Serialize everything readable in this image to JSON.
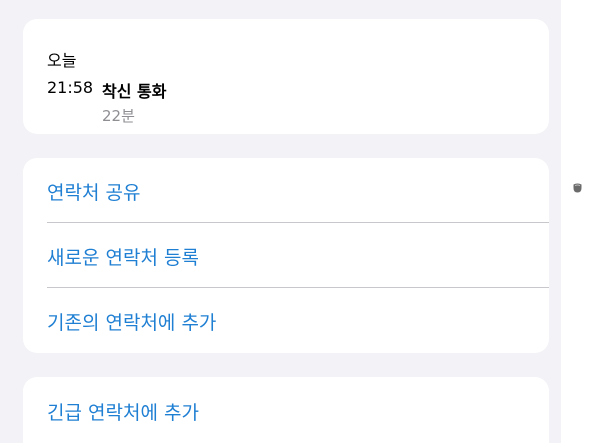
{
  "recents": {
    "day": "오늘",
    "time": "21:58",
    "type": "착신 통화",
    "duration": "22분"
  },
  "actions": [
    {
      "label": "연락처 공유"
    },
    {
      "label": "새로운 연락처 등록"
    },
    {
      "label": "기존의 연락처에 추가"
    }
  ],
  "emergency": {
    "label": "긴급 연락처에 추가"
  },
  "colors": {
    "background": "#f2f2f7",
    "card": "#ffffff",
    "link": "#1f7fd3",
    "secondary_text": "#8e8e93",
    "divider": "#c8c8cc"
  },
  "icons": {
    "scroll_knob": "scroll-indicator-icon"
  }
}
